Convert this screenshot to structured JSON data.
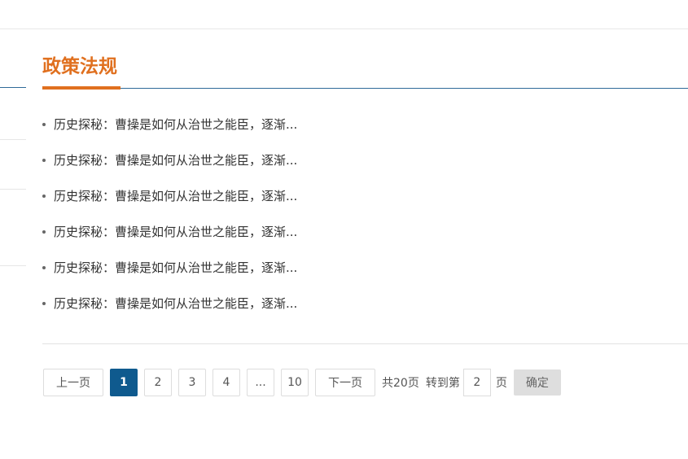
{
  "section": {
    "title": "政策法规",
    "accent_color": "#e0701f",
    "rule_color": "#2e6a99"
  },
  "news": {
    "items": [
      "历史探秘：曹操是如何从治世之能臣，逐渐...",
      "历史探秘：曹操是如何从治世之能臣，逐渐...",
      "历史探秘：曹操是如何从治世之能臣，逐渐...",
      "历史探秘：曹操是如何从治世之能臣，逐渐...",
      "历史探秘：曹操是如何从治世之能臣，逐渐...",
      "历史探秘：曹操是如何从治世之能臣，逐渐..."
    ]
  },
  "pagination": {
    "prev_label": "上一页",
    "pages": [
      "1",
      "2",
      "3",
      "4",
      "...",
      "10"
    ],
    "current_page": "1",
    "next_label": "下一页",
    "total_text": "共20页",
    "goto_prefix": "转到第",
    "goto_value": "2",
    "goto_suffix": "页",
    "confirm_label": "确定",
    "active_color": "#0f5a8e"
  }
}
